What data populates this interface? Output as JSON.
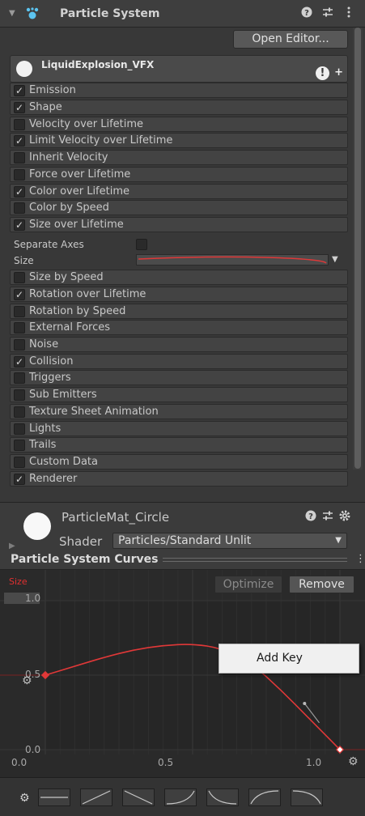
{
  "component": {
    "title": "Particle System",
    "foldout_icon": "triangle-down-icon",
    "icon": "particle-system-icon",
    "header_icons": [
      "help-icon",
      "preset-sliders-icon",
      "kebab-menu-icon"
    ],
    "open_editor_label": "Open Editor..."
  },
  "system": {
    "name": "LiquidExplosion_VFX",
    "warning_icon": "warning-icon",
    "add_icon": "plus-icon"
  },
  "modules": [
    {
      "label": "Emission",
      "enabled": true
    },
    {
      "label": "Shape",
      "enabled": true
    },
    {
      "label": "Velocity over Lifetime",
      "enabled": false
    },
    {
      "label": "Limit Velocity over Lifetime",
      "enabled": true
    },
    {
      "label": "Inherit Velocity",
      "enabled": false
    },
    {
      "label": "Force over Lifetime",
      "enabled": false
    },
    {
      "label": "Color over Lifetime",
      "enabled": true
    },
    {
      "label": "Color by Speed",
      "enabled": false
    },
    {
      "label": "Size over Lifetime",
      "enabled": true
    },
    {
      "label": "Size by Speed",
      "enabled": false
    },
    {
      "label": "Rotation over Lifetime",
      "enabled": true
    },
    {
      "label": "Rotation by Speed",
      "enabled": false
    },
    {
      "label": "External Forces",
      "enabled": false
    },
    {
      "label": "Noise",
      "enabled": false
    },
    {
      "label": "Collision",
      "enabled": true
    },
    {
      "label": "Triggers",
      "enabled": false
    },
    {
      "label": "Sub Emitters",
      "enabled": false
    },
    {
      "label": "Texture Sheet Animation",
      "enabled": false
    },
    {
      "label": "Lights",
      "enabled": false
    },
    {
      "label": "Trails",
      "enabled": false
    },
    {
      "label": "Custom Data",
      "enabled": false
    },
    {
      "label": "Renderer",
      "enabled": true
    }
  ],
  "size_over_lifetime": {
    "separate_axes_label": "Separate Axes",
    "separate_axes": false,
    "size_label": "Size"
  },
  "material": {
    "name": "ParticleMat_Circle",
    "shader_label": "Shader",
    "shader_value": "Particles/Standard Unlit",
    "icons": [
      "help-icon",
      "preset-sliders-icon",
      "gear-icon"
    ]
  },
  "curves": {
    "title": "Particle System Curves",
    "curve_name": "Size",
    "curve_color": "#e03838",
    "optimize_label": "Optimize",
    "remove_label": "Remove",
    "y_ticks": [
      "1.0",
      "0.5",
      "0.0"
    ],
    "x_ticks": [
      "0.0",
      "0.5",
      "1.0"
    ],
    "context_menu_item": "Add Key",
    "keys": [
      {
        "t": 0.0,
        "v": 0.5
      },
      {
        "t": 1.0,
        "v": 0.0
      }
    ],
    "curve_points": [
      [
        0.0,
        0.5
      ],
      [
        0.1,
        0.56
      ],
      [
        0.2,
        0.62
      ],
      [
        0.3,
        0.67
      ],
      [
        0.4,
        0.7
      ],
      [
        0.5,
        0.71
      ],
      [
        0.6,
        0.68
      ],
      [
        0.7,
        0.58
      ],
      [
        0.8,
        0.4
      ],
      [
        0.9,
        0.2
      ],
      [
        1.0,
        0.0
      ]
    ],
    "presets": [
      "flat",
      "linear-up",
      "linear-down",
      "ease-in",
      "ease-out-down",
      "ease-out",
      "ease-in-down"
    ]
  },
  "colors": {
    "accent_red": "#e03838",
    "panel_bg": "#383838",
    "curve_bg": "#2a2a2a"
  }
}
